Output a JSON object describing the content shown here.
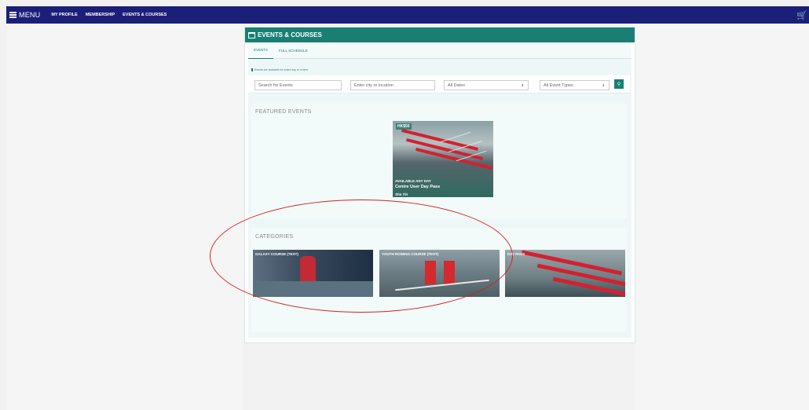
{
  "topbar": {
    "menu_label": "MENU",
    "nav": [
      "MY PROFILE",
      "MEMBERSHIP",
      "EVENTS & COURSES"
    ],
    "cart_icon": "cart-icon"
  },
  "panel": {
    "title": "EVENTS & COURSES",
    "tabs": [
      "EVENTS",
      "FULL SCHEDULE"
    ],
    "hint": "Events are available for entire day or in time"
  },
  "filters": {
    "search_placeholder": "Search for Events",
    "location_placeholder": "Enter city or location",
    "dates_value": "All Dates",
    "types_value": "All Event Types"
  },
  "featured": {
    "title": "FEATURED EVENTS",
    "event": {
      "price": "HK$50",
      "availability": "AVAILABLE ANY DAY",
      "name": "Centre User Day Pass",
      "location": "Sha Tin"
    }
  },
  "categories": {
    "title": "CATEGORIES",
    "items": [
      {
        "label": "GALAXY COURSE (TEST)"
      },
      {
        "label": "YOUTH ROWING COURSE (TEST)"
      },
      {
        "label": "DAY PASS"
      }
    ]
  },
  "colors": {
    "nav_bg": "#1b1f78",
    "accent": "#1a7f72",
    "annotation": "#d42222"
  }
}
